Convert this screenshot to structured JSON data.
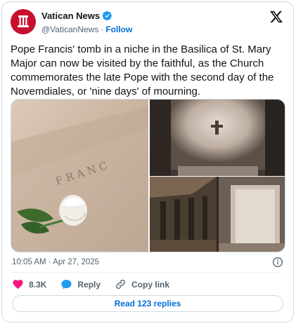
{
  "author": {
    "display_name": "Vatican News",
    "handle": "@VaticanNews",
    "separator": "·",
    "follow_label": "Follow",
    "brand_color": "#c8102e",
    "verified": true
  },
  "tweet": {
    "text": "Pope Francis' tomb in a niche in the Basilica of St. Mary Major can now be visited by the faithful, as the Church commemorates the late Pope with the second day of the Novemdiales, or 'nine days' of mourning.",
    "timestamp": "10:05 AM · Apr 27, 2025"
  },
  "media": {
    "image_1": "tomb-stone-with-white-rose",
    "image_2": "niche-with-cross",
    "image_3": "basilica-interior"
  },
  "actions": {
    "likes": "8.3K",
    "reply_label": "Reply",
    "copy_link_label": "Copy link",
    "like_color": "#f91880",
    "icon_color": "#1d9bf0"
  },
  "footer": {
    "read_replies_label": "Read 123 replies"
  }
}
